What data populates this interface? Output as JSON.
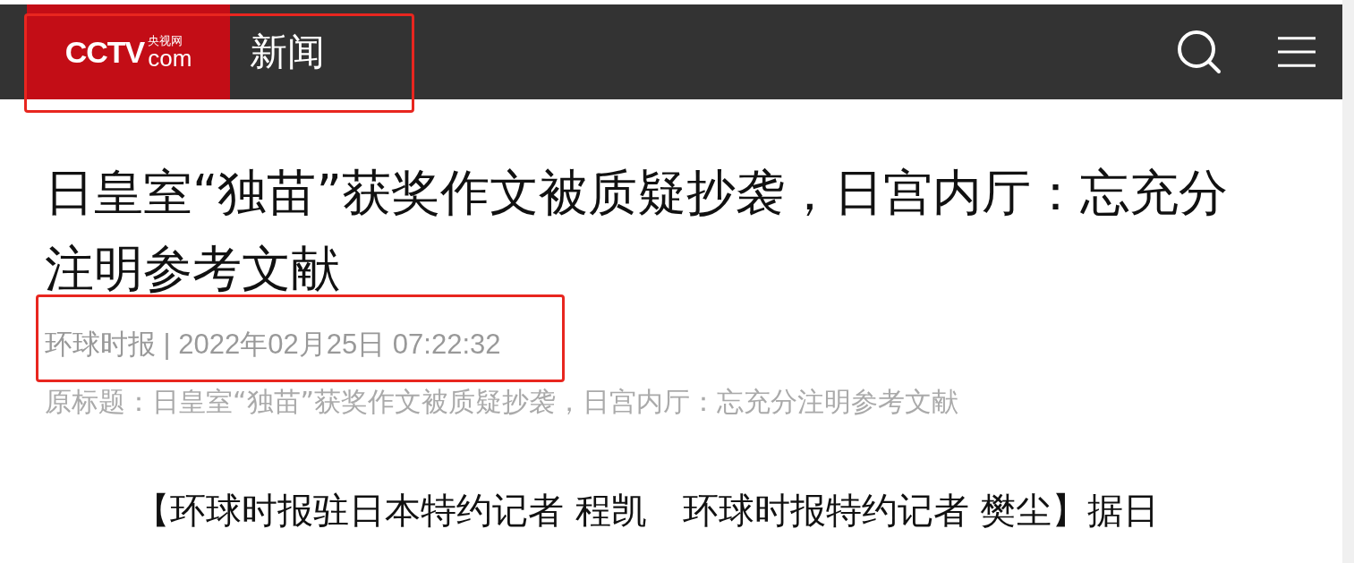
{
  "header": {
    "logo": {
      "mark": "CCTV",
      "cn": "央视网",
      "domain": "com"
    },
    "section": "新闻",
    "highlighted": true
  },
  "article": {
    "title": "日皇室“独苗”获奖作文被质疑抄袭，日宫内厅：忘充分注明参考文献",
    "byline": {
      "source": "环球时报",
      "separator": "|",
      "date": "2022年02月25日 07:22:32",
      "highlighted": true
    },
    "original_title": "原标题：日皇室“独苗”获奖作文被质疑抄袭，日宫内厅：忘充分注明参考文献",
    "paragraph": "【环球时报驻日本特约记者 程凯　环球时报特约记者 樊尘】据日"
  }
}
